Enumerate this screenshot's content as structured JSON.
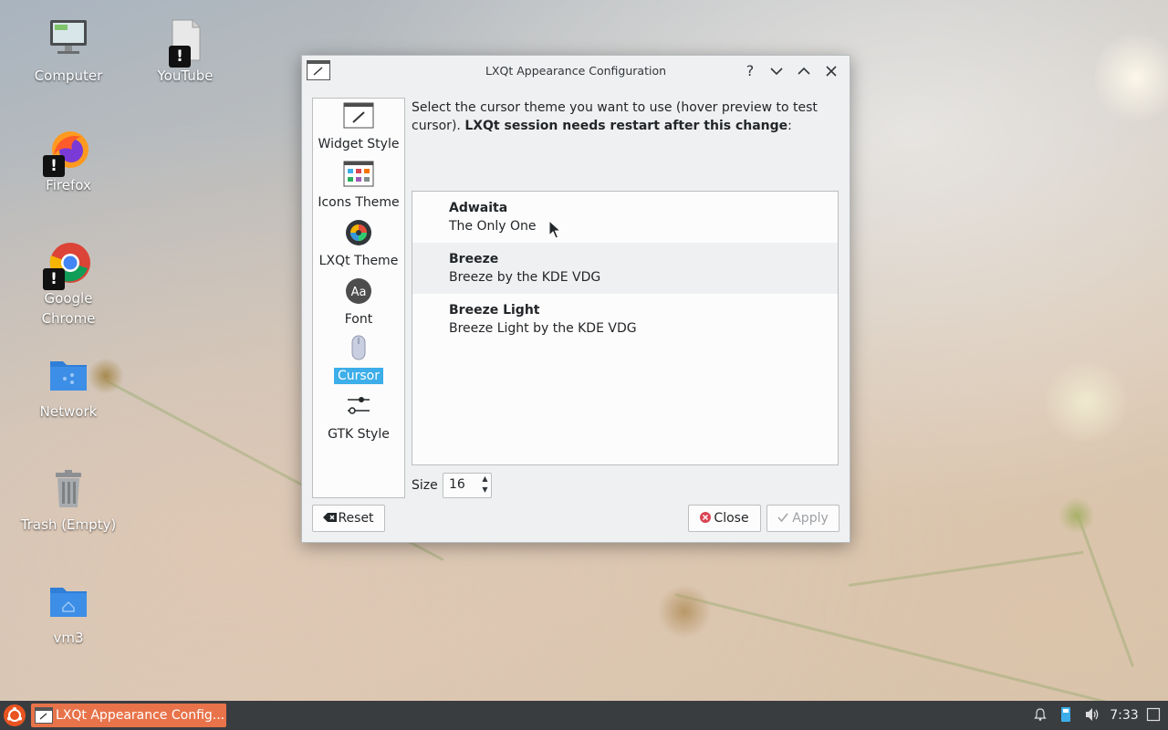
{
  "desktop": {
    "icons": [
      {
        "label": "Computer"
      },
      {
        "label": "YouTube"
      },
      {
        "label": "Firefox"
      },
      {
        "label": "Google Chrome"
      },
      {
        "label": "Network"
      },
      {
        "label": "Trash (Empty)"
      },
      {
        "label": "vm3"
      }
    ]
  },
  "window": {
    "title": "LXQt Appearance Configuration",
    "help_glyph": "?",
    "minimize_glyph": "⌄",
    "maximize_glyph": "⌃",
    "close_glyph": "✕",
    "sidebar": [
      {
        "label": "Widget Style",
        "icon": "brush-icon"
      },
      {
        "label": "Icons Theme",
        "icon": "icons-theme-icon"
      },
      {
        "label": "LXQt Theme",
        "icon": "lxqt-theme-icon"
      },
      {
        "label": "Font",
        "icon": "font-icon"
      },
      {
        "label": "Cursor",
        "icon": "cursor-mouse-icon",
        "selected": true
      },
      {
        "label": "GTK Style",
        "icon": "gtk-style-icon"
      }
    ],
    "description_plain": "Select the cursor theme you want to use (hover preview to test cursor). ",
    "description_bold": "LXQt session needs restart after this change",
    "description_end": ":",
    "themes": [
      {
        "name": "Adwaita",
        "comment": "The Only One"
      },
      {
        "name": "Breeze",
        "comment": "Breeze by the KDE VDG"
      },
      {
        "name": "Breeze Light",
        "comment": "Breeze Light by the KDE VDG"
      }
    ],
    "size_label": "Size",
    "size_value": "16",
    "reset_label": "Reset",
    "close_label": "Close",
    "apply_label": "Apply"
  },
  "taskbar": {
    "task_label": "LXQt Appearance Config...",
    "clock": "7:33"
  },
  "colors": {
    "selection": "#3daee9",
    "taskbar": "#3a3d40",
    "active_task": "#e8734a",
    "menu_button": "#e95420"
  }
}
